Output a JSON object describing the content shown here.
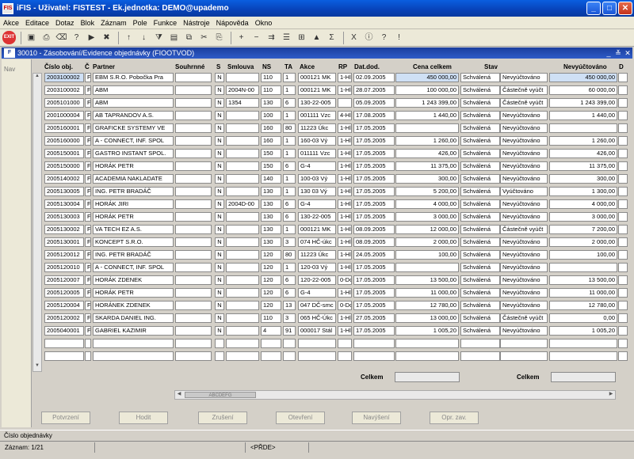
{
  "window": {
    "title": "iFIS - Uživatel: FISTEST - Ek.jednotka: DEMO@upademo"
  },
  "menu": [
    "Akce",
    "Editace",
    "Dotaz",
    "Blok",
    "Záznam",
    "Pole",
    "Funkce",
    "Nástroje",
    "Nápověda",
    "Okno"
  ],
  "toolbar_icons": [
    "exit-icon",
    "save-icon",
    "print-icon",
    "clear-icon",
    "query-icon",
    "execute-icon",
    "cancel-query-icon",
    "sort-asc-icon",
    "sort-desc-icon",
    "filter-icon",
    "print-preview-icon",
    "copy-icon",
    "cut-icon",
    "paste-icon",
    "insert-record-icon",
    "delete-record-icon",
    "duplicate-icon",
    "list-icon",
    "tree-icon",
    "chart-icon",
    "sum-icon",
    "excel-icon",
    "info-icon",
    "help-icon",
    "about-icon"
  ],
  "form": {
    "title": "30010 - Zásobování/Evidence objednávky (FIOOTVOD)",
    "nav_label": "Nav"
  },
  "columns": [
    "Číslo obj.",
    "Č",
    "Partner",
    "Souhrnné",
    "S",
    "Smlouva",
    "NS",
    "TA",
    "Akce",
    "RP",
    "Dat.dod.",
    "Cena celkem",
    "Stav",
    "",
    "Nevyúčtováno",
    "D"
  ],
  "rows": [
    [
      "2003100002",
      "F",
      "EBM S.R.O. Pobočka Pra",
      "",
      "N",
      "",
      "110",
      "1",
      "000121 MK",
      "1-Hl",
      "02.09.2005",
      "450 000,00",
      "Schválená",
      "Nevyúčtováno",
      "450 000,00"
    ],
    [
      "2003100002",
      "F",
      "ABM",
      "",
      "N",
      "2004N-00",
      "110",
      "1",
      "000121 MK",
      "1-Hl",
      "28.07.2005",
      "100 000,00",
      "Schválená",
      "Částečně vyúčt",
      "60 000,00"
    ],
    [
      "2005101000",
      "F",
      "ABM",
      "",
      "N",
      "1354",
      "130",
      "6",
      "130-22-005",
      "",
      "05.09.2005",
      "1 243 399,00",
      "Schválená",
      "Částečně vyúčt",
      "1 243 399,00"
    ],
    [
      "2001000004",
      "F",
      "AB TAPRANDOV A.S.",
      "",
      "N",
      "",
      "100",
      "1",
      "001111 Vzc",
      "4-Hl",
      "17.08.2005",
      "1 440,00",
      "Schválená",
      "Nevyúčtováno",
      "1 440,00"
    ],
    [
      "2005160001",
      "F",
      "GRAFICKE SYSTEMY VE",
      "",
      "N",
      "",
      "160",
      "80",
      "11223 Úkc",
      "1-Hl",
      "17.05.2005",
      "",
      "Schválená",
      "Nevyúčtováno",
      ""
    ],
    [
      "2005160000",
      "F",
      "A - CONNECT, INF. SPOL",
      "",
      "N",
      "",
      "160",
      "1",
      "160-03 Vý",
      "1-Hl",
      "17.05.2005",
      "1 260,00",
      "Schválená",
      "Nevyúčtováno",
      "1 260,00"
    ],
    [
      "2005150001",
      "F",
      "GASTRO INSTANT SPOL.",
      "",
      "N",
      "",
      "150",
      "1",
      "011111 Vzc",
      "1-Hl",
      "17.05.2005",
      "426,00",
      "Schválená",
      "Nevyúčtováno",
      "426,00"
    ],
    [
      "2005150000",
      "F",
      "HORÁK PETR",
      "",
      "N",
      "",
      "150",
      "6",
      "G-4",
      "1-Hl",
      "17.05.2005",
      "11 375,00",
      "Schválená",
      "Nevyúčtováno",
      "11 375,00"
    ],
    [
      "2005140002",
      "F",
      "ACADEMIA NAKLADATE",
      "",
      "N",
      "",
      "140",
      "1",
      "100-03 Vý",
      "1-Hl",
      "17.05.2005",
      "300,00",
      "Schválená",
      "Nevyúčtováno",
      "300,00"
    ],
    [
      "2005130005",
      "F",
      "ING. PETR BRADÁČ",
      "",
      "N",
      "",
      "130",
      "1",
      "130 03 Vý",
      "1-Hl",
      "17.05.2005",
      "5 200,00",
      "Schválená",
      "Vyúčtováno",
      "1 300,00"
    ],
    [
      "2005130004",
      "F",
      "HORÁK JIRI",
      "",
      "N",
      "2004D-00",
      "130",
      "6",
      "G-4",
      "1-Hl",
      "17.05.2005",
      "4 000,00",
      "Schválená",
      "Nevyúčtováno",
      "4 000,00"
    ],
    [
      "2005130003",
      "F",
      "HORÁK PETR",
      "",
      "N",
      "",
      "130",
      "6",
      "130-22-005",
      "1-Hl",
      "17.05.2005",
      "3 000,00",
      "Schválená",
      "Nevyúčtováno",
      "3 000,00"
    ],
    [
      "2005130002",
      "F",
      "VA TECH EZ A.S.",
      "",
      "N",
      "",
      "130",
      "1",
      "000121 MK",
      "1-Hl",
      "08.09.2005",
      "12 000,00",
      "Schválená",
      "Částečně vyúčt",
      "7 200,00"
    ],
    [
      "2005130001",
      "F",
      "KONCEPT S.R.O.",
      "",
      "N",
      "",
      "130",
      "3",
      "074 HČ-úkc",
      "1-Hl",
      "08.09.2005",
      "2 000,00",
      "Schválená",
      "Nevyúčtováno",
      "2 000,00"
    ],
    [
      "2005120012",
      "F",
      "ING. PETR BRADÁČ",
      "",
      "N",
      "",
      "120",
      "80",
      "11223 Úkc",
      "1-Hl",
      "24.05.2005",
      "100,00",
      "Schválená",
      "Nevyúčtováno",
      "100,00"
    ],
    [
      "2005120010",
      "F",
      "A - CONNECT, INF. SPOL",
      "",
      "N",
      "",
      "120",
      "1",
      "120-03 Vý",
      "1-Hl",
      "17.05.2005",
      "",
      "Schválená",
      "Nevyúčtováno",
      ""
    ],
    [
      "2005120007",
      "F",
      "HORÁK ZDENEK",
      "",
      "N",
      "",
      "120",
      "6",
      "120-22-005",
      "0-Dc",
      "17.05.2005",
      "13 500,00",
      "Schválená",
      "Nevyúčtováno",
      "13 500,00"
    ],
    [
      "2005120005",
      "F",
      "HORÁK PETR",
      "",
      "N",
      "",
      "120",
      "6",
      "G-4",
      "1-Hl",
      "17.05.2005",
      "11 000,00",
      "Schválená",
      "Nevyúčtováno",
      "11 000,00"
    ],
    [
      "2005120004",
      "F",
      "HORÁNEK ZDENEK",
      "",
      "N",
      "",
      "120",
      "13",
      "047 DČ-smc",
      "0-Dc",
      "17.05.2005",
      "12 780,00",
      "Schválená",
      "Nevyúčtováno",
      "12 780,00"
    ],
    [
      "2005120002",
      "F",
      "SKARDA DANIEL ING.",
      "",
      "N",
      "",
      "110",
      "3",
      "065 HČ-Úkc",
      "1-Hl",
      "27.05.2005",
      "13 000,00",
      "Schválená",
      "Částečně vyúčt",
      "0,00"
    ],
    [
      "2005040001",
      "F",
      "GABRIEL KAZIMIR",
      "",
      "N",
      "",
      "4",
      "91",
      "000017 Stál",
      "1-Hl",
      "17.05.2005",
      "1 005,20",
      "Schválená",
      "Nevyúčtováno",
      "1 005,20"
    ]
  ],
  "totals": {
    "label1": "Celkem",
    "label2": "Celkem"
  },
  "scroll": {
    "thumb": "ABCDEFG"
  },
  "buttons": [
    "Potvrzení",
    "Hodit",
    "Zrušení",
    "Otevření",
    "Navýšení",
    "Opr. zav."
  ],
  "status": {
    "field": "Číslo objednávky",
    "record": "Záznam: 1/21",
    "mode": "",
    "extra": "<PŘDE>"
  }
}
